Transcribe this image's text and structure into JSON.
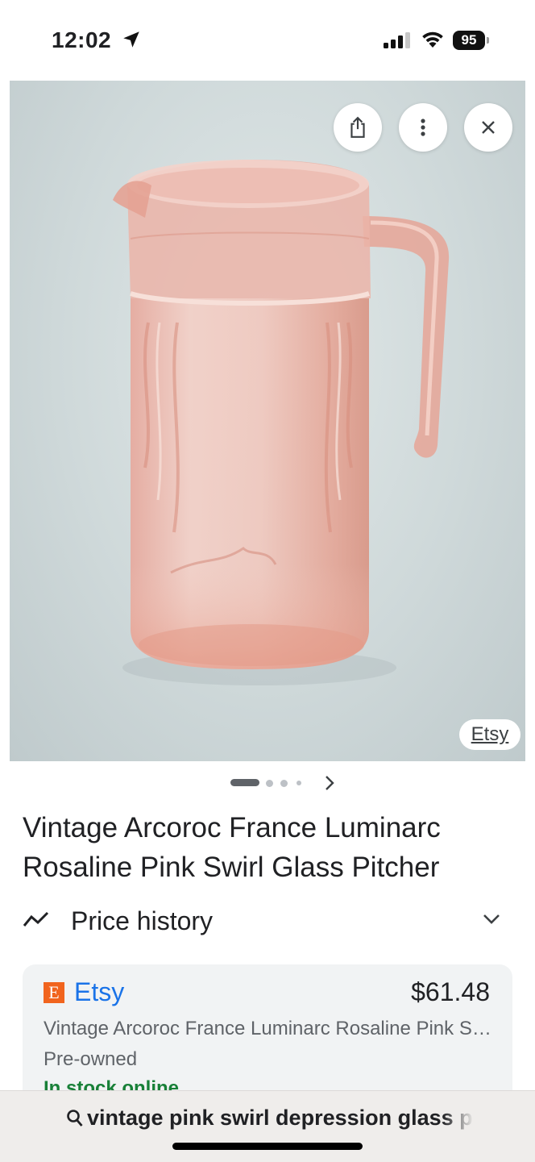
{
  "status_bar": {
    "time": "12:02",
    "battery": "95",
    "icons": [
      "location-arrow-icon",
      "cellular-signal-icon",
      "wifi-icon",
      "battery-icon"
    ]
  },
  "image_viewer": {
    "source_label": "Etsy",
    "buttons": [
      "share-icon",
      "more-vertical-icon",
      "close-icon"
    ],
    "page_count": 4,
    "current_page": 1
  },
  "product": {
    "title": "Vintage Arcoroc France Luminarc Rosaline Pink Swirl Glass Pitcher"
  },
  "price_history": {
    "label": "Price history"
  },
  "offer": {
    "store_logo": "E",
    "store": "Etsy",
    "price": "$61.48",
    "description": "Vintage Arcoroc France Luminarc Rosaline Pink Swirl Glass Pitcher",
    "condition": "Pre-owned",
    "availability": "In stock online"
  },
  "search": {
    "query": "vintage pink swirl depression glass pitcher"
  },
  "colors": {
    "link_blue": "#1a73e8",
    "etsy_orange": "#f1641e",
    "in_stock_green": "#188038",
    "card_bg": "#f1f3f4"
  }
}
